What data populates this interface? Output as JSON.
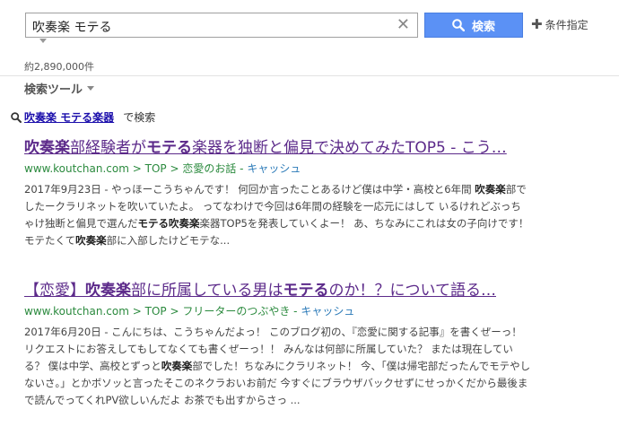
{
  "search": {
    "query": "吹奏楽 モテる",
    "clear_label": "✕",
    "button_label": "検索",
    "conditions_label": "条件指定",
    "plus": "✚"
  },
  "result_count": "約2,890,000件",
  "search_tools_label": "検索ツール",
  "suggestion": {
    "link_bold": "吹奏楽 モテる楽器",
    "tail": "で検索"
  },
  "results": [
    {
      "title_parts": [
        {
          "t": "吹奏楽",
          "b": true
        },
        {
          "t": "部経験者が",
          "b": false
        },
        {
          "t": "モテる",
          "b": true
        },
        {
          "t": "楽器を独断と偏見で決めてみたTOP5 - こう…",
          "b": false
        }
      ],
      "url_domain": "www.koutchan.com",
      "url_crumbs": [
        "TOP",
        "恋愛のお話"
      ],
      "cache_label": "キャッシュ",
      "date": "2017年9月23日",
      "snippet_parts": [
        {
          "t": "2017年9月23日 - やっほーこうちゃんです！ 何回か言ったことあるけど僕は中学・高校と6年間 ",
          "b": false
        },
        {
          "t": "吹奏楽",
          "b": true
        },
        {
          "t": "部で したークラリネットを吹いていたよ。 ってなわけで今回は6年間の経験を一応元にはして いるけれどぶっちゃけ独断と偏見で選んだ",
          "b": false
        },
        {
          "t": "モテる吹奏楽",
          "b": true
        },
        {
          "t": "楽器TOP5を発表していくよー！ あ、ちなみにこれは女の子向けです！モテたくて",
          "b": false
        },
        {
          "t": "吹奏楽",
          "b": true
        },
        {
          "t": "部に入部したけどモテな...",
          "b": false
        }
      ]
    },
    {
      "title_parts": [
        {
          "t": "【恋愛】",
          "b": false
        },
        {
          "t": "吹奏楽",
          "b": true
        },
        {
          "t": "部に所属している男は",
          "b": false
        },
        {
          "t": "モテる",
          "b": true
        },
        {
          "t": "のか！？について語る…",
          "b": false
        }
      ],
      "url_domain": "www.koutchan.com",
      "url_crumbs": [
        "TOP",
        "フリーターのつぶやき"
      ],
      "cache_label": "キャッシュ",
      "date": "2017年6月20日",
      "snippet_parts": [
        {
          "t": "2017年6月20日 - こんにちは、こうちゃんだよっ！ このブログ初の、『恋愛に関する記事』を書くぜーっ！ リクエストにお答えしてもしてなくても書くぜーっ！！ みんなは何部に所属していた？ または現在している？ 僕は中学、高校とずっと",
          "b": false
        },
        {
          "t": "吹奏楽",
          "b": true
        },
        {
          "t": "部でした！ちなみにクラリネット！ 今、「僕は帰宅部だったんでモテやしないさ。」とかボソッと言ったそこのネクラおいお前だ 今すぐにブラウザバックせずにせっかくだから最後まで読んでってくれPV欲しいんだよ お茶でも出すからさっ ...",
          "b": false
        }
      ]
    }
  ]
}
